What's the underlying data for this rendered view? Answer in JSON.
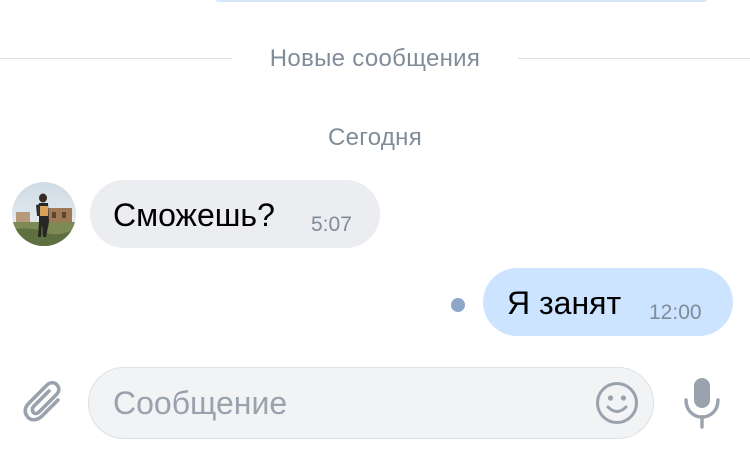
{
  "divider": {
    "label": "Новые сообщения"
  },
  "date_separator": {
    "label": "Сегодня"
  },
  "messages": [
    {
      "direction": "incoming",
      "text": "Сможешь?",
      "time": "5:07",
      "avatar": "contact-photo"
    },
    {
      "direction": "outgoing",
      "text": "Я занят",
      "time": "12:00",
      "status": "unread-dot"
    }
  ],
  "composer": {
    "placeholder": "Сообщение",
    "attach_icon": "paperclip-icon",
    "emoji_icon": "smiley-icon",
    "voice_icon": "microphone-icon"
  },
  "colors": {
    "incoming_bubble": "#ebedf0",
    "outgoing_bubble": "#cce4ff",
    "secondary_text": "#818c99",
    "icon_gray": "#99a2ad",
    "unread_dot": "#8ea6c8"
  }
}
